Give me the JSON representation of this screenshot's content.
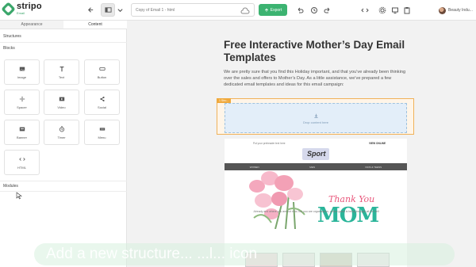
{
  "app": {
    "logo_text": "stripo",
    "logo_sub": "Email"
  },
  "toolbar": {
    "file_name": "Copy of Email 1 - html",
    "export_label": "Export",
    "user_name": "Beauty Indu..."
  },
  "left_panel": {
    "tabs": [
      {
        "label": "Appearance",
        "active": false
      },
      {
        "label": "Content",
        "active": true
      }
    ],
    "structures_label": "Structures",
    "blocks_label": "Blocks",
    "blocks": [
      {
        "label": "Image",
        "icon": "image-icon"
      },
      {
        "label": "Text",
        "icon": "text-icon"
      },
      {
        "label": "Button",
        "icon": "button-icon"
      },
      {
        "label": "Spacer",
        "icon": "spacer-icon"
      },
      {
        "label": "Video",
        "icon": "video-icon"
      },
      {
        "label": "Social",
        "icon": "share-icon"
      },
      {
        "label": "Banner",
        "icon": "banner-icon"
      },
      {
        "label": "Timer",
        "icon": "timer-icon"
      },
      {
        "label": "Menu",
        "icon": "menu-icon"
      },
      {
        "label": "HTML",
        "icon": "code-icon"
      }
    ],
    "modules_label": "Modules"
  },
  "canvas": {
    "article_title": "Free Interactive Mother’s Day Email Templates",
    "article_body": "We are pretty sure that you find this Holiday important, and that you’ve already been thinking over the sales and offers to Mother’s Day. As a little assistance, we’ve prepared a few dedicated email templates and ideas for this email campaign:",
    "drop_tag": "1 Stru...",
    "drop_zone_text": "Drop content here",
    "email": {
      "preheader": "Put your preheader text here",
      "view_online": "VIEW ONLINE",
      "brand": "Sport",
      "nav": [
        "WOMEN",
        "MEN",
        "KIDS & TEENS"
      ],
      "thank_you": "Thank You",
      "mom": "MOM",
      "caption": "Already and where you are not new, but you are organization, yellow gavel is being brought all the hell"
    }
  },
  "toast": {
    "text": "Add a new structure... ...l... icon"
  },
  "colors": {
    "accent_green": "#3cb371",
    "drop_border": "#f0b25a",
    "mom_teal": "#2bb59a",
    "thank_pink": "#e8557a"
  }
}
